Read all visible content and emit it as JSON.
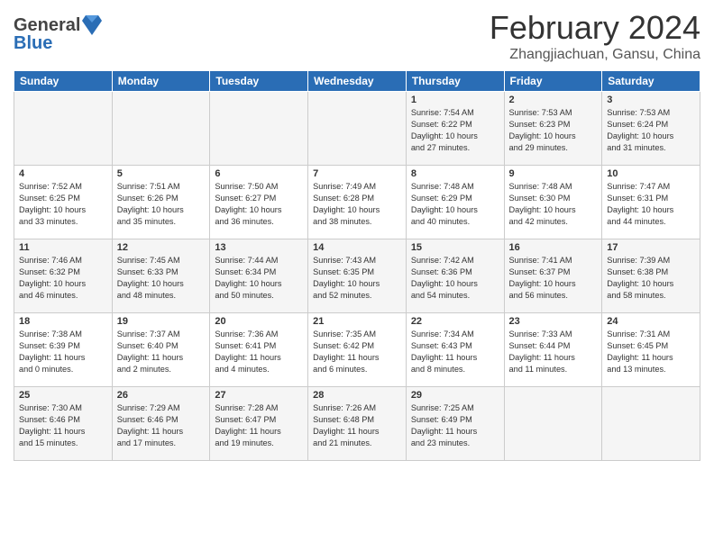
{
  "header": {
    "logo_line1": "General",
    "logo_line2": "Blue",
    "month_title": "February 2024",
    "location": "Zhangjiachuan, Gansu, China"
  },
  "days_of_week": [
    "Sunday",
    "Monday",
    "Tuesday",
    "Wednesday",
    "Thursday",
    "Friday",
    "Saturday"
  ],
  "weeks": [
    [
      {
        "day": "",
        "info": ""
      },
      {
        "day": "",
        "info": ""
      },
      {
        "day": "",
        "info": ""
      },
      {
        "day": "",
        "info": ""
      },
      {
        "day": "1",
        "info": "Sunrise: 7:54 AM\nSunset: 6:22 PM\nDaylight: 10 hours\nand 27 minutes."
      },
      {
        "day": "2",
        "info": "Sunrise: 7:53 AM\nSunset: 6:23 PM\nDaylight: 10 hours\nand 29 minutes."
      },
      {
        "day": "3",
        "info": "Sunrise: 7:53 AM\nSunset: 6:24 PM\nDaylight: 10 hours\nand 31 minutes."
      }
    ],
    [
      {
        "day": "4",
        "info": "Sunrise: 7:52 AM\nSunset: 6:25 PM\nDaylight: 10 hours\nand 33 minutes."
      },
      {
        "day": "5",
        "info": "Sunrise: 7:51 AM\nSunset: 6:26 PM\nDaylight: 10 hours\nand 35 minutes."
      },
      {
        "day": "6",
        "info": "Sunrise: 7:50 AM\nSunset: 6:27 PM\nDaylight: 10 hours\nand 36 minutes."
      },
      {
        "day": "7",
        "info": "Sunrise: 7:49 AM\nSunset: 6:28 PM\nDaylight: 10 hours\nand 38 minutes."
      },
      {
        "day": "8",
        "info": "Sunrise: 7:48 AM\nSunset: 6:29 PM\nDaylight: 10 hours\nand 40 minutes."
      },
      {
        "day": "9",
        "info": "Sunrise: 7:48 AM\nSunset: 6:30 PM\nDaylight: 10 hours\nand 42 minutes."
      },
      {
        "day": "10",
        "info": "Sunrise: 7:47 AM\nSunset: 6:31 PM\nDaylight: 10 hours\nand 44 minutes."
      }
    ],
    [
      {
        "day": "11",
        "info": "Sunrise: 7:46 AM\nSunset: 6:32 PM\nDaylight: 10 hours\nand 46 minutes."
      },
      {
        "day": "12",
        "info": "Sunrise: 7:45 AM\nSunset: 6:33 PM\nDaylight: 10 hours\nand 48 minutes."
      },
      {
        "day": "13",
        "info": "Sunrise: 7:44 AM\nSunset: 6:34 PM\nDaylight: 10 hours\nand 50 minutes."
      },
      {
        "day": "14",
        "info": "Sunrise: 7:43 AM\nSunset: 6:35 PM\nDaylight: 10 hours\nand 52 minutes."
      },
      {
        "day": "15",
        "info": "Sunrise: 7:42 AM\nSunset: 6:36 PM\nDaylight: 10 hours\nand 54 minutes."
      },
      {
        "day": "16",
        "info": "Sunrise: 7:41 AM\nSunset: 6:37 PM\nDaylight: 10 hours\nand 56 minutes."
      },
      {
        "day": "17",
        "info": "Sunrise: 7:39 AM\nSunset: 6:38 PM\nDaylight: 10 hours\nand 58 minutes."
      }
    ],
    [
      {
        "day": "18",
        "info": "Sunrise: 7:38 AM\nSunset: 6:39 PM\nDaylight: 11 hours\nand 0 minutes."
      },
      {
        "day": "19",
        "info": "Sunrise: 7:37 AM\nSunset: 6:40 PM\nDaylight: 11 hours\nand 2 minutes."
      },
      {
        "day": "20",
        "info": "Sunrise: 7:36 AM\nSunset: 6:41 PM\nDaylight: 11 hours\nand 4 minutes."
      },
      {
        "day": "21",
        "info": "Sunrise: 7:35 AM\nSunset: 6:42 PM\nDaylight: 11 hours\nand 6 minutes."
      },
      {
        "day": "22",
        "info": "Sunrise: 7:34 AM\nSunset: 6:43 PM\nDaylight: 11 hours\nand 8 minutes."
      },
      {
        "day": "23",
        "info": "Sunrise: 7:33 AM\nSunset: 6:44 PM\nDaylight: 11 hours\nand 11 minutes."
      },
      {
        "day": "24",
        "info": "Sunrise: 7:31 AM\nSunset: 6:45 PM\nDaylight: 11 hours\nand 13 minutes."
      }
    ],
    [
      {
        "day": "25",
        "info": "Sunrise: 7:30 AM\nSunset: 6:46 PM\nDaylight: 11 hours\nand 15 minutes."
      },
      {
        "day": "26",
        "info": "Sunrise: 7:29 AM\nSunset: 6:46 PM\nDaylight: 11 hours\nand 17 minutes."
      },
      {
        "day": "27",
        "info": "Sunrise: 7:28 AM\nSunset: 6:47 PM\nDaylight: 11 hours\nand 19 minutes."
      },
      {
        "day": "28",
        "info": "Sunrise: 7:26 AM\nSunset: 6:48 PM\nDaylight: 11 hours\nand 21 minutes."
      },
      {
        "day": "29",
        "info": "Sunrise: 7:25 AM\nSunset: 6:49 PM\nDaylight: 11 hours\nand 23 minutes."
      },
      {
        "day": "",
        "info": ""
      },
      {
        "day": "",
        "info": ""
      }
    ]
  ]
}
